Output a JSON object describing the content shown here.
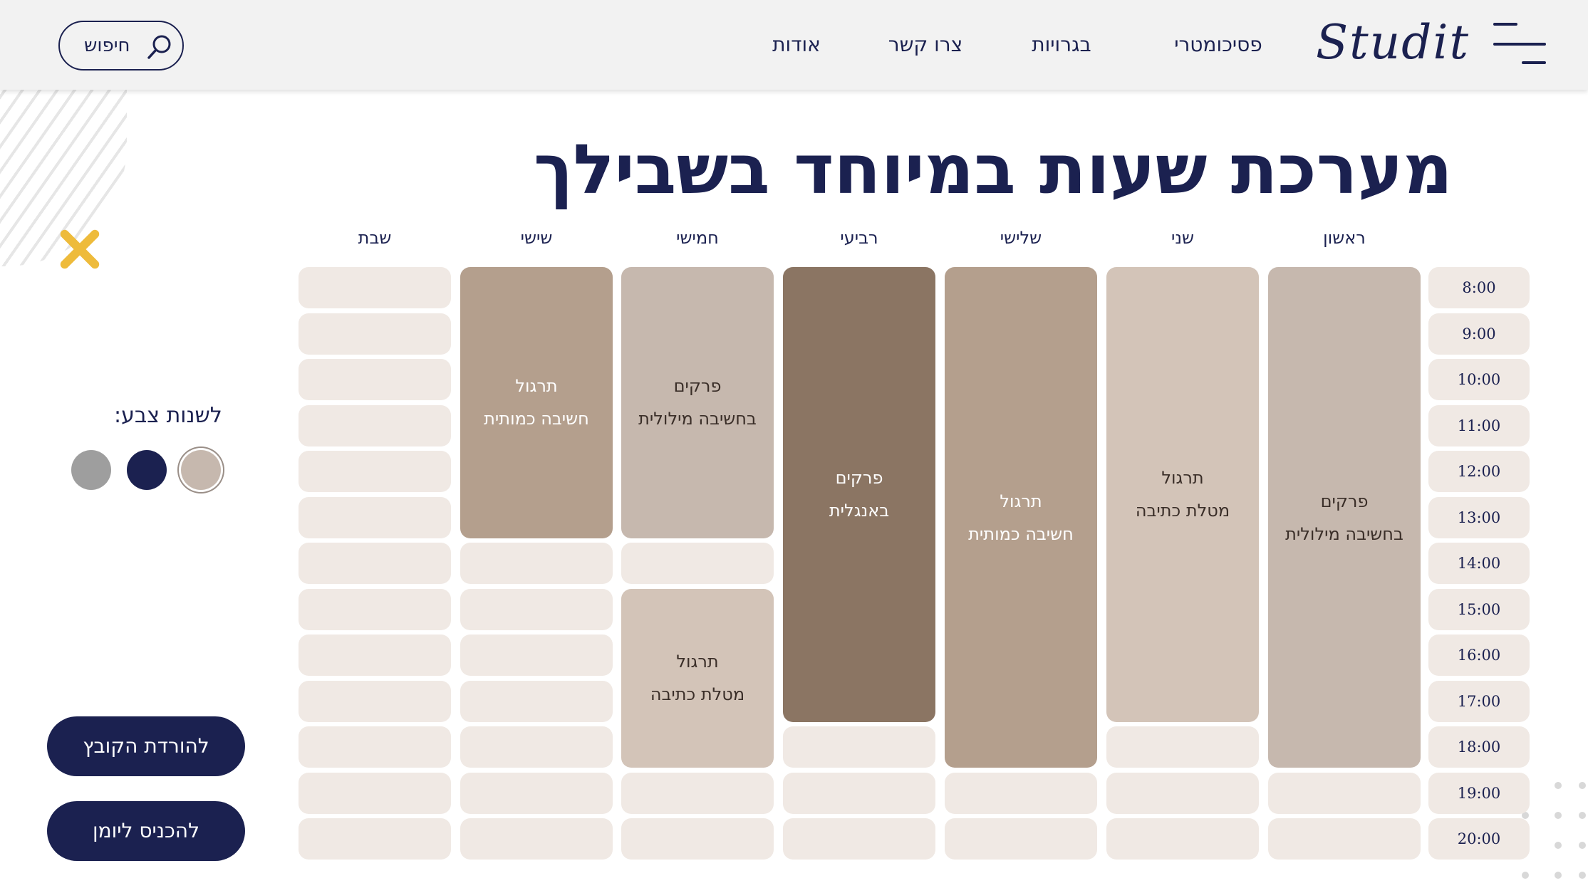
{
  "header": {
    "logo": "Studit",
    "nav": [
      "פסיכומטרי",
      "בגרויות",
      "צרו קשר",
      "אודות"
    ],
    "search_label": "חיפוש"
  },
  "title": "מערכת שעות במיוחד בשבילך",
  "schedule": {
    "days": [
      "ראשון",
      "שני",
      "שלישי",
      "רביעי",
      "חמישי",
      "שישי",
      "שבת"
    ],
    "times": [
      "8:00",
      "9:00",
      "10:00",
      "11:00",
      "12:00",
      "13:00",
      "14:00",
      "15:00",
      "16:00",
      "17:00",
      "18:00",
      "19:00",
      "20:00"
    ],
    "events": [
      {
        "day": "ראשון",
        "start": "8:00",
        "end": "19:00",
        "line1": "פרקים",
        "line2": "בחשיבה מילולית",
        "color": "#c6b8ae",
        "text_color": "#3a2e28"
      },
      {
        "day": "שני",
        "start": "8:00",
        "end": "18:00",
        "line1": "תרגול",
        "line2": "מטלת כתיבה",
        "color": "#d3c4b8",
        "text_color": "#3a2e28"
      },
      {
        "day": "שלישי",
        "start": "8:00",
        "end": "19:00",
        "line1": "תרגול",
        "line2": "חשיבה כמותית",
        "color": "#b49f8d",
        "text_color": "#ffffff"
      },
      {
        "day": "רביעי",
        "start": "8:00",
        "end": "18:00",
        "line1": "פרקים",
        "line2": "באנגלית",
        "color": "#8b7563",
        "text_color": "#ffffff"
      },
      {
        "day": "חמישי",
        "start": "8:00",
        "end": "14:00",
        "line1": "פרקים",
        "line2": "בחשיבה מילולית",
        "color": "#c6b8ae",
        "text_color": "#3a2e28"
      },
      {
        "day": "חמישי",
        "start": "15:00",
        "end": "19:00",
        "line1": "תרגול",
        "line2": "מטלת כתיבה",
        "color": "#d3c4b8",
        "text_color": "#3a2e28"
      },
      {
        "day": "שישי",
        "start": "8:00",
        "end": "14:00",
        "line1": "תרגול",
        "line2": "חשיבה כמותית",
        "color": "#b49f8d",
        "text_color": "#ffffff"
      }
    ]
  },
  "colors": {
    "label": "לשנות צבע:",
    "swatches": [
      "#c6b8ae",
      "#1b2150",
      "#9e9e9e"
    ],
    "selected": "#c6b8ae"
  },
  "buttons": {
    "download": "להורדת הקובץ",
    "calendar": "להכניס ליומן"
  }
}
